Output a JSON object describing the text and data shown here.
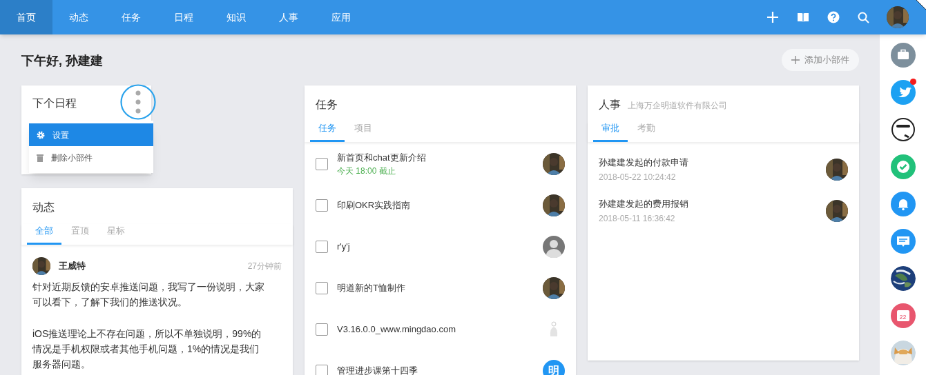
{
  "nav": {
    "items": [
      {
        "label": "首页",
        "selected": true
      },
      {
        "label": "动态",
        "selected": false
      },
      {
        "label": "任务",
        "selected": false
      },
      {
        "label": "日程",
        "selected": false
      },
      {
        "label": "知识",
        "selected": false
      },
      {
        "label": "人事",
        "selected": false
      },
      {
        "label": "应用",
        "selected": false
      }
    ]
  },
  "greeting": "下午好, 孙建建",
  "add_widget": "添加小部件",
  "schedule_widget": {
    "title": "下个日程",
    "menu": [
      {
        "label": "设置",
        "selected": true
      },
      {
        "label": "删除小部件",
        "selected": false
      }
    ]
  },
  "feed_widget": {
    "title": "动态",
    "tabs": [
      {
        "label": "全部",
        "selected": true
      },
      {
        "label": "置顶",
        "selected": false
      },
      {
        "label": "星标",
        "selected": false
      }
    ],
    "posts": [
      {
        "author": "王威特",
        "time": "27分钟前",
        "paragraphs": [
          "针对近期反馈的安卓推送问题，我写了一份说明，大家可以看下，了解下我们的推送状况。",
          "iOS推送理论上不存在问题，所以不单独说明，99%的情况是手机权限或者其他手机问题，1%的情况是我们服务器问题。"
        ]
      }
    ]
  },
  "task_widget": {
    "title": "任务",
    "tabs": [
      {
        "label": "任务",
        "selected": true
      },
      {
        "label": "项目",
        "selected": false
      }
    ],
    "tasks": [
      {
        "title": "新首页和chat更新介绍",
        "due": "今天 18:00 截止",
        "checked": false
      },
      {
        "title": "印刷OKR实践指南",
        "checked": false
      },
      {
        "title": "r'y'j",
        "checked": false,
        "assignee": {
          "kind": "default"
        }
      },
      {
        "title": "明道新的T恤制作",
        "checked": false
      },
      {
        "title": "V3.16.0.0_www.mingdao.com",
        "checked": false,
        "assignee": {
          "kind": "faint"
        }
      },
      {
        "title": "管理进步课第十四季",
        "checked": false,
        "assignee": {
          "kind": "initial",
          "text": "明"
        }
      }
    ]
  },
  "hr_widget": {
    "title": "人事",
    "company": "上海万企明道软件有限公司",
    "tabs": [
      {
        "label": "审批",
        "selected": true
      },
      {
        "label": "考勤",
        "selected": false
      }
    ],
    "approvals": [
      {
        "title": "孙建建发起的付款申请",
        "time": "2018-05-22 10:24:42"
      },
      {
        "title": "孙建建发起的费用报销",
        "time": "2018-05-11 16:36:42"
      }
    ]
  },
  "dock": [
    {
      "kind": "briefcase",
      "badge": false
    },
    {
      "kind": "bird",
      "badge": true
    },
    {
      "kind": "sticker",
      "badge": false
    },
    {
      "kind": "check",
      "badge": false
    },
    {
      "kind": "bell",
      "badge": false
    },
    {
      "kind": "chat",
      "badge": false
    },
    {
      "kind": "globe",
      "badge": false
    },
    {
      "kind": "calendar",
      "text": "22",
      "badge": false
    },
    {
      "kind": "cat",
      "badge": false
    }
  ]
}
